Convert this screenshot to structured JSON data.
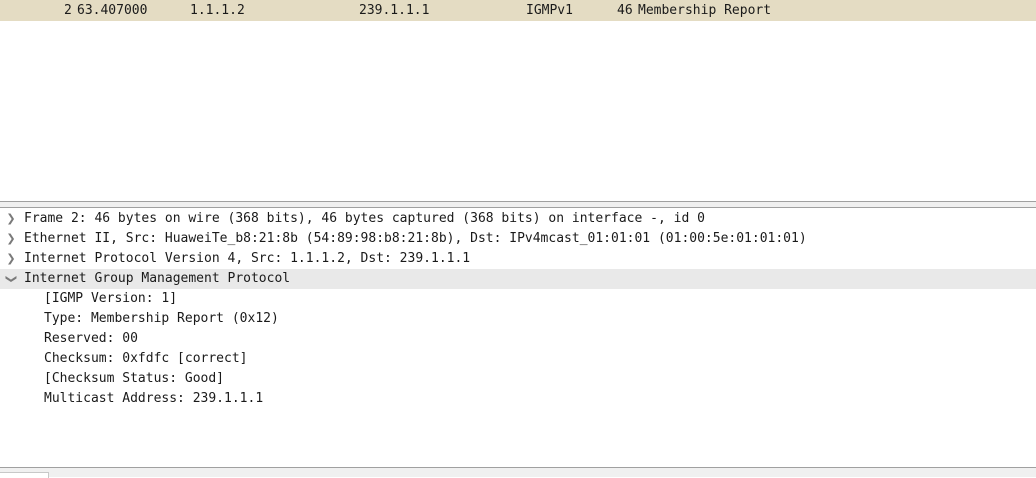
{
  "packet_list": {
    "rows": [
      {
        "no": "2",
        "time": "63.407000",
        "source": "1.1.1.2",
        "destination": "239.1.1.1",
        "protocol": "IGMPv1",
        "length": "46",
        "info": "Membership Report",
        "color": "#e4dcc3"
      }
    ]
  },
  "details": {
    "items": [
      {
        "text": "Frame 2: 46 bytes on wire (368 bits), 46 bytes captured (368 bits) on interface -, id 0",
        "expanded": false,
        "icon": "chevron-right-icon"
      },
      {
        "text": "Ethernet II, Src: HuaweiTe_b8:21:8b (54:89:98:b8:21:8b), Dst: IPv4mcast_01:01:01 (01:00:5e:01:01:01)",
        "expanded": false,
        "icon": "chevron-right-icon"
      },
      {
        "text": "Internet Protocol Version 4, Src: 1.1.1.2, Dst: 239.1.1.1",
        "expanded": false,
        "icon": "chevron-right-icon"
      },
      {
        "text": "Internet Group Management Protocol",
        "expanded": true,
        "icon": "chevron-down-icon"
      }
    ],
    "igmp_children": [
      "[IGMP Version: 1]",
      "Type: Membership Report (0x12)",
      "Reserved: 00",
      "Checksum: 0xfdfc [correct]",
      "[Checksum Status: Good]",
      "Multicast Address: 239.1.1.1"
    ]
  }
}
